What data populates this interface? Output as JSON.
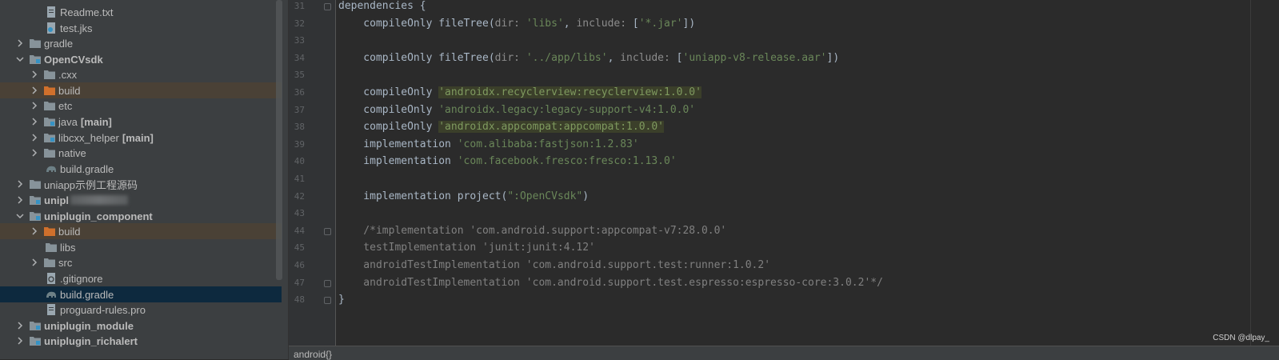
{
  "tree": {
    "items": [
      {
        "label": "Readme.txt"
      },
      {
        "label": "test.jks"
      },
      {
        "label": "gradle"
      },
      {
        "label": "OpenCVsdk"
      },
      {
        "label": ".cxx"
      },
      {
        "label": "build"
      },
      {
        "label": "etc"
      },
      {
        "label": "java",
        "tag": "[main]"
      },
      {
        "label": "libcxx_helper",
        "tag": "[main]"
      },
      {
        "label": "native"
      },
      {
        "label": "build.gradle"
      },
      {
        "label": "uniapp示例工程源码"
      },
      {
        "label": "unipl"
      },
      {
        "label": "uniplugin_component"
      },
      {
        "label": "build"
      },
      {
        "label": "libs"
      },
      {
        "label": "src"
      },
      {
        "label": ".gitignore"
      },
      {
        "label": "build.gradle"
      },
      {
        "label": "proguard-rules.pro"
      },
      {
        "label": "uniplugin_module"
      },
      {
        "label": "uniplugin_richalert"
      }
    ]
  },
  "editor": {
    "lines": [
      {
        "n": "31",
        "t": [
          {
            "c": "plain",
            "s": "dependencies {"
          }
        ]
      },
      {
        "n": "32",
        "t": [
          {
            "c": "plain",
            "s": "    compileOnly fileTree("
          },
          {
            "c": "param",
            "s": "dir: "
          },
          {
            "c": "str",
            "s": "'libs'"
          },
          {
            "c": "plain",
            "s": ", "
          },
          {
            "c": "param",
            "s": "include: "
          },
          {
            "c": "plain",
            "s": "["
          },
          {
            "c": "str",
            "s": "'*.jar'"
          },
          {
            "c": "plain",
            "s": "])"
          }
        ]
      },
      {
        "n": "33",
        "t": []
      },
      {
        "n": "34",
        "t": [
          {
            "c": "plain",
            "s": "    compileOnly fileTree("
          },
          {
            "c": "param",
            "s": "dir: "
          },
          {
            "c": "str",
            "s": "'../app/libs'"
          },
          {
            "c": "plain",
            "s": ", "
          },
          {
            "c": "param",
            "s": "include: "
          },
          {
            "c": "plain",
            "s": "["
          },
          {
            "c": "str",
            "s": "'uniapp-v8-release.aar'"
          },
          {
            "c": "plain",
            "s": "])"
          }
        ]
      },
      {
        "n": "35",
        "t": []
      },
      {
        "n": "36",
        "t": [
          {
            "c": "plain",
            "s": "    compileOnly "
          },
          {
            "c": "str hl",
            "s": "'androidx.recyclerview:recyclerview:1.0.0'"
          }
        ]
      },
      {
        "n": "37",
        "t": [
          {
            "c": "plain",
            "s": "    compileOnly "
          },
          {
            "c": "str",
            "s": "'androidx.legacy:legacy-support-v4:1.0.0'"
          }
        ]
      },
      {
        "n": "38",
        "t": [
          {
            "c": "plain",
            "s": "    compileOnly "
          },
          {
            "c": "str hl",
            "s": "'androidx.appcompat:appcompat:1.0.0'"
          }
        ]
      },
      {
        "n": "39",
        "t": [
          {
            "c": "plain",
            "s": "    implementation "
          },
          {
            "c": "str",
            "s": "'com.alibaba:fastjson:1.2.83'"
          }
        ]
      },
      {
        "n": "40",
        "t": [
          {
            "c": "plain",
            "s": "    implementation "
          },
          {
            "c": "str",
            "s": "'com.facebook.fresco:fresco:1.13.0'"
          }
        ]
      },
      {
        "n": "41",
        "t": []
      },
      {
        "n": "42",
        "t": [
          {
            "c": "plain",
            "s": "    implementation project("
          },
          {
            "c": "str",
            "s": "\":OpenCVsdk\""
          },
          {
            "c": "plain",
            "s": ")"
          }
        ]
      },
      {
        "n": "43",
        "t": []
      },
      {
        "n": "44",
        "t": [
          {
            "c": "comment",
            "s": "    /*implementation 'com.android.support:appcompat-v7:28.0.0'"
          }
        ]
      },
      {
        "n": "45",
        "t": [
          {
            "c": "comment",
            "s": "    testImplementation 'junit:junit:4.12'"
          }
        ]
      },
      {
        "n": "46",
        "t": [
          {
            "c": "comment",
            "s": "    androidTestImplementation 'com.android.support.test:runner:1.0.2'"
          }
        ]
      },
      {
        "n": "47",
        "t": [
          {
            "c": "comment",
            "s": "    androidTestImplementation 'com.android.support.test.espresso:espresso-core:3.0.2'*/"
          }
        ]
      },
      {
        "n": "48",
        "t": [
          {
            "c": "plain",
            "s": "}"
          }
        ]
      }
    ]
  },
  "statusbar": {
    "text": "android{}"
  },
  "watermark": {
    "text": "CSDN @dlpay_"
  },
  "colors": {
    "tree_bg": "#3c3f41",
    "editor_bg": "#2b2b2b",
    "string": "#6a8759",
    "build_folder": "#d0702c",
    "selection": "#0d293e"
  }
}
